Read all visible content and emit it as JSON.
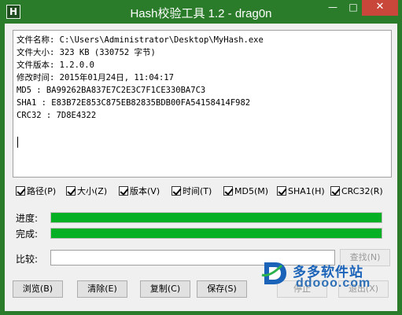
{
  "window": {
    "icon_letter": "H",
    "title": "Hash校验工具 1.2 - drag0n",
    "minimize_glyph": "—",
    "maximize_glyph": "□",
    "close_glyph": "✕"
  },
  "info": {
    "lines": [
      "文件名称: C:\\Users\\Administrator\\Desktop\\MyHash.exe",
      "文件大小: 323 KB (330752 字节)",
      "文件版本: 1.2.0.0",
      "修改时间: 2015年01月24日, 11:04:17",
      "MD5     : BA99262BA837E7C2E3C7F1CE330BA7C3",
      "SHA1    : E83B72E853C875EB82835BDB00FA54158414F982",
      "CRC32   : 7D8E4322"
    ]
  },
  "options": [
    {
      "label": "路径(P)",
      "checked": true
    },
    {
      "label": "大小(Z)",
      "checked": true
    },
    {
      "label": "版本(V)",
      "checked": true
    },
    {
      "label": "时间(T)",
      "checked": true
    },
    {
      "label": "MD5(M)",
      "checked": true
    },
    {
      "label": "SHA1(H)",
      "checked": true
    },
    {
      "label": "CRC32(R)",
      "checked": true
    }
  ],
  "progress": {
    "label": "进度:",
    "value": 1.0
  },
  "complete": {
    "label": "完成:",
    "value": 1.0
  },
  "compare": {
    "label": "比较:",
    "value": "",
    "find_label": "查找(N)"
  },
  "buttons": {
    "browse": "浏览(B)",
    "clear": "清除(E)",
    "copy": "复制(C)",
    "save": "保存(S)",
    "stop": "停止",
    "exit": "退出(X)"
  },
  "watermark": {
    "line1": "多多软件站",
    "line2": "ddooo.com"
  },
  "colors": {
    "titlebar": "#2a7c2a",
    "progress_fill": "#06b025",
    "close_button": "#c9463a",
    "watermark_blue": "#1a63b8"
  }
}
